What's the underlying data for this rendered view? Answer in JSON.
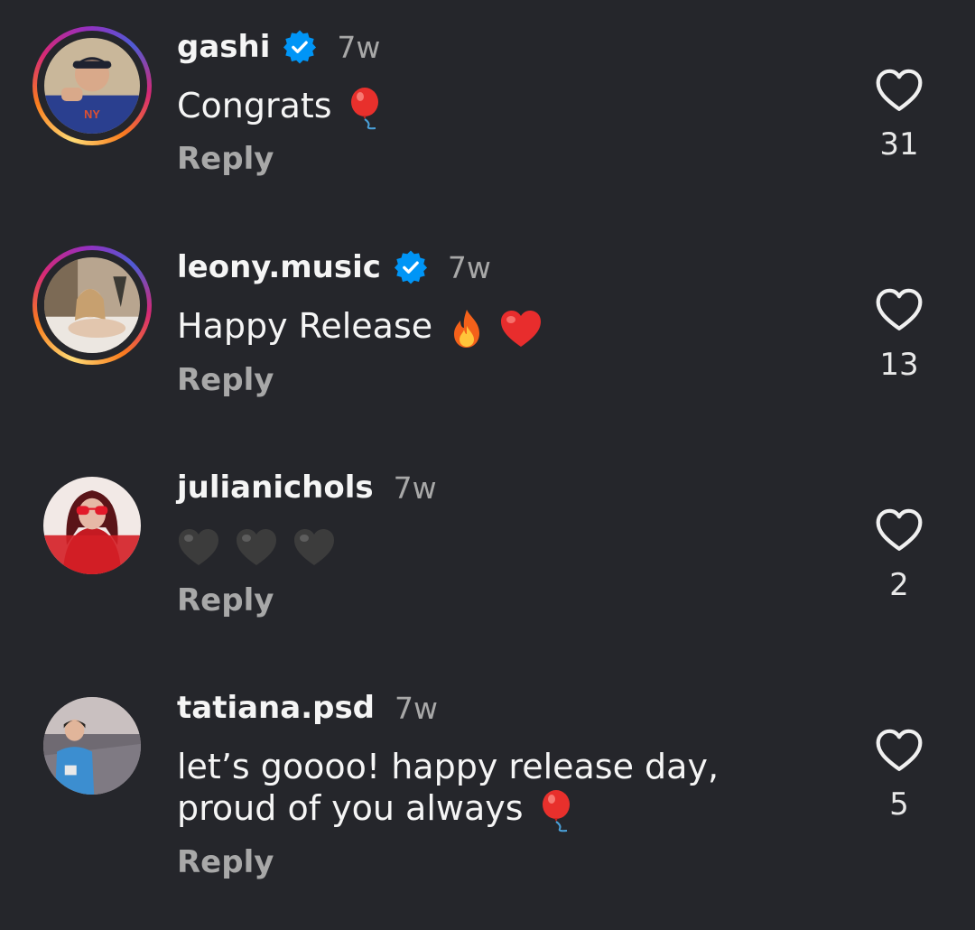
{
  "comments": [
    {
      "username": "gashi",
      "verified": true,
      "time": "7w",
      "text": "Congrats",
      "emojis": [
        "balloon"
      ],
      "reply_label": "Reply",
      "likes": "31",
      "has_story_ring": true
    },
    {
      "username": "leony.music",
      "verified": true,
      "time": "7w",
      "text": "Happy Release",
      "emojis": [
        "fire",
        "red-heart"
      ],
      "reply_label": "Reply",
      "likes": "13",
      "has_story_ring": true
    },
    {
      "username": "julianichols",
      "verified": false,
      "time": "7w",
      "text": "",
      "emojis": [
        "black-heart",
        "black-heart",
        "black-heart"
      ],
      "reply_label": "Reply",
      "likes": "2",
      "has_story_ring": false
    },
    {
      "username": "tatiana.psd",
      "verified": false,
      "time": "7w",
      "text_line1": "let’s goooo! happy release day,",
      "text_line2": "proud of you always",
      "emojis": [
        "balloon"
      ],
      "reply_label": "Reply",
      "likes": "5",
      "has_story_ring": false
    }
  ],
  "colors": {
    "background": "#25262b",
    "verified_blue": "#0095f6",
    "secondary_text": "#a8a8a8"
  }
}
